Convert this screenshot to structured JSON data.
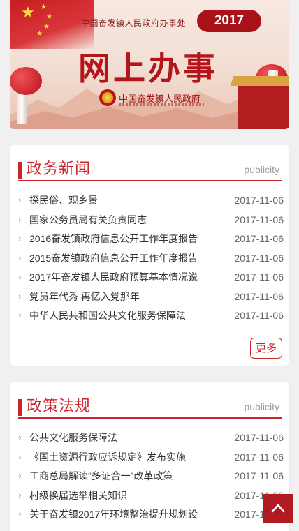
{
  "banner": {
    "office_label": "中国奋发镇人民政府办事处",
    "year": "2017",
    "title": "网上办事",
    "gov_name": "中国奋发镇人民政府",
    "emblem_icon": "national-emblem-icon"
  },
  "news_section": {
    "title": "政务新闻",
    "subtitle": "publicity",
    "items": [
      {
        "title": "探民俗、观乡景",
        "date": "2017-11-06"
      },
      {
        "title": "国家公务员局有关负责同志",
        "date": "2017-11-06"
      },
      {
        "title": "2016奋发镇政府信息公开工作年度报告",
        "date": "2017-11-06"
      },
      {
        "title": "2015奋发镇政府信息公开工作年度报告",
        "date": "2017-11-06"
      },
      {
        "title": "2017年奋发镇人民政府预算基本情况说",
        "date": "2017-11-06"
      },
      {
        "title": "党员年代秀 再忆入党那年",
        "date": "2017-11-06"
      },
      {
        "title": "中华人民共和国公共文化服务保障法",
        "date": "2017-11-06"
      }
    ],
    "more_label": "更多"
  },
  "policy_section": {
    "title": "政策法规",
    "subtitle": "publicity",
    "items": [
      {
        "title": "公共文化服务保障法",
        "date": "2017-11-06"
      },
      {
        "title": "《国土资源行政应诉规定》发布实施",
        "date": "2017-11-06"
      },
      {
        "title": "工商总局解读“多证合一”改革政策",
        "date": "2017-11-06"
      },
      {
        "title": "村级换届选举相关知识",
        "date": "2017-11-06"
      },
      {
        "title": "关于奋发镇2017年环境整治提升规划设",
        "date": "2017-11-06"
      }
    ]
  },
  "back_to_top": {
    "icon": "chevron-up-icon"
  },
  "colors": {
    "accent": "#c8252c",
    "banner_dark_red": "#a8131a",
    "back_top_bg": "#b01c22",
    "page_bg": "#f0f0f0"
  }
}
